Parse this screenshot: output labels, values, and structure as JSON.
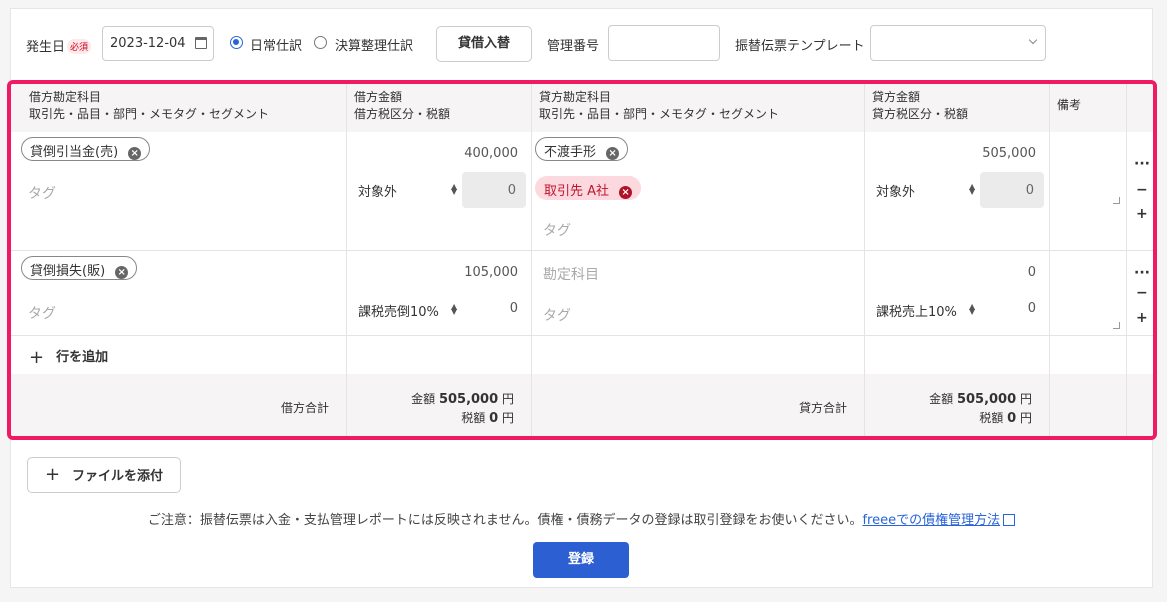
{
  "header": {
    "date_label": "発生日",
    "required_badge": "必須",
    "date_value": "2023-12-04",
    "radio_normal": "日常仕訳",
    "radio_closing": "決算整理仕訳",
    "swap_button": "貸借入替",
    "mgmt_label": "管理番号",
    "mgmt_value": "",
    "template_label": "振替伝票テンプレート",
    "template_value": ""
  },
  "table": {
    "col_debit_account": [
      "借方勘定科目",
      "取引先・品目・部門・メモタグ・セグメント"
    ],
    "col_debit_amount": [
      "借方金額",
      "借方税区分・税額"
    ],
    "col_credit_account": [
      "貸方勘定科目",
      "取引先・品目・部門・メモタグ・セグメント"
    ],
    "col_credit_amount": [
      "貸方金額",
      "貸方税区分・税額"
    ],
    "col_memo": "備考",
    "rows": [
      {
        "debit_account": "貸倒引当金(売)",
        "debit_tag_placeholder": "タグ",
        "debit_amount": "400,000",
        "debit_tax": "対象外",
        "debit_tax_amount": "0",
        "credit_account": "不渡手形",
        "credit_partner": "取引先  A社",
        "credit_tag_placeholder": "タグ",
        "credit_amount": "505,000",
        "credit_tax": "対象外",
        "credit_tax_amount": "0"
      },
      {
        "debit_account": "貸倒損失(販)",
        "debit_tag_placeholder": "タグ",
        "debit_amount": "105,000",
        "debit_tax": "課税売倒10%",
        "debit_tax_amount": "0",
        "credit_account_placeholder": "勘定科目",
        "credit_tag_placeholder": "タグ",
        "credit_amount": "0",
        "credit_tax": "課税売上10%",
        "credit_tax_amount": "0"
      }
    ],
    "add_row": "行を追加",
    "debit_total_label": "借方合計",
    "credit_total_label": "貸方合計",
    "amount_label": "金額",
    "tax_label": "税額",
    "debit_total_amount": "505,000",
    "debit_total_tax": "0",
    "credit_total_amount": "505,000",
    "credit_total_tax": "0",
    "yen": "円"
  },
  "attach_button": "ファイルを添付",
  "notice_text": "ご注意：振替伝票は入金・支払管理レポートには反映されません。債権・債務データの登録は取引登録をお使いください。",
  "notice_link": "freeeでの債権管理方法",
  "submit_button": "登録",
  "colors": {
    "accent": "#2c5fd1",
    "highlight_border": "#f01a64"
  }
}
